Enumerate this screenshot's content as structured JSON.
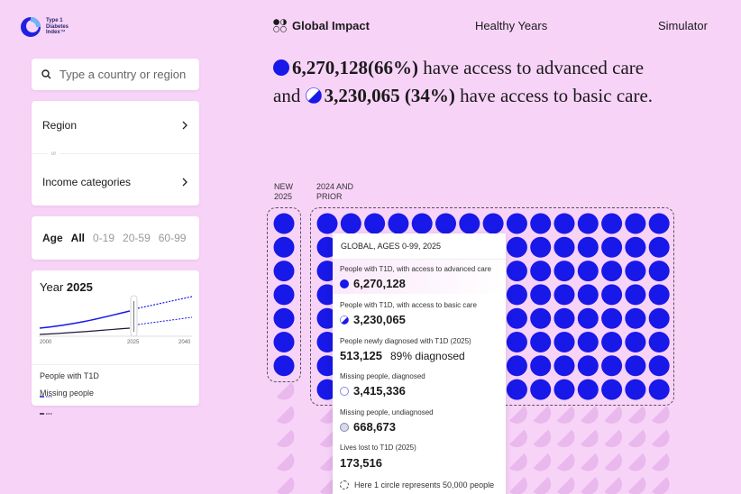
{
  "brand": {
    "line1": "Type 1",
    "line2": "Diabetes",
    "line3": "Index",
    "tm": "™"
  },
  "nav": {
    "global": "Global Impact",
    "healthy": "Healthy Years",
    "simulator": "Simulator"
  },
  "search": {
    "placeholder": "Type a country or region"
  },
  "filters": {
    "region": "Region",
    "or": "or",
    "income": "Income categories"
  },
  "age": {
    "title": "Age",
    "options": [
      "All",
      "0-19",
      "20-59",
      "60-99"
    ],
    "selected": "All"
  },
  "year": {
    "label": "Year",
    "value": "2025",
    "axis": [
      "2000",
      "2025",
      "2040"
    ],
    "legend": {
      "t1d": "People with T1D",
      "missing": "Missing people"
    }
  },
  "headline": {
    "advanced_value": "6,270,128",
    "advanced_pct": "(66%)",
    "advanced_text": "have access to advanced care",
    "and": "and",
    "basic_value": "3,230,065",
    "basic_pct": "(34%)",
    "basic_text": "have access to basic care."
  },
  "grid": {
    "new_label_1": "NEW",
    "new_label_2": "2025",
    "prior_label_1": "2024 AND",
    "prior_label_2": "PRIOR"
  },
  "tooltip": {
    "title": "GLOBAL, AGES 0-99, 2025",
    "advanced_label": "People with T1D, with access to advanced care",
    "advanced_value": "6,270,128",
    "basic_label": "People with T1D, with access to basic care",
    "basic_value": "3,230,065",
    "newly_label": "People newly diagnosed with T1D (2025)",
    "newly_value": "513,125",
    "newly_sub": "89% diagnosed",
    "missing_diag_label": "Missing people, diagnosed",
    "missing_diag_value": "3,415,336",
    "missing_undiag_label": "Missing people, undiagnosed",
    "missing_undiag_value": "668,673",
    "lives_label": "Lives lost to T1D (2025)",
    "lives_value": "173,516",
    "note": "Here 1 circle represents 50,000 people"
  },
  "colors": {
    "accent": "#1818e8",
    "background": "#f8d3f8",
    "missing": "#e9b8ec",
    "dark_line": "#1a1a3a"
  }
}
